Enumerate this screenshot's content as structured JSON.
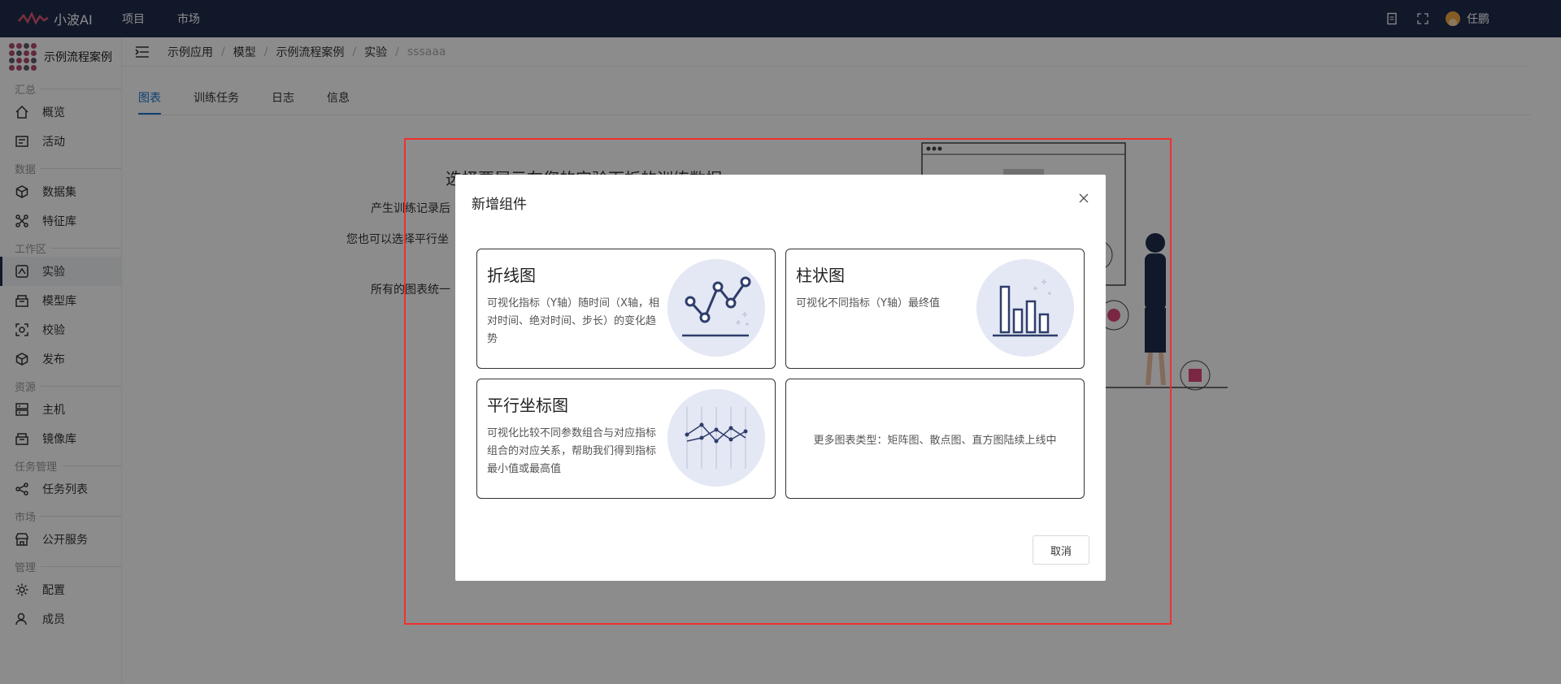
{
  "topbar": {
    "brand": "小波AI",
    "nav": [
      "项目",
      "市场"
    ],
    "user_name": "任鹏"
  },
  "sidebar": {
    "project_name": "示例流程案例",
    "groups": {
      "summary": "汇总",
      "data": "数据",
      "workspace": "工作区",
      "resource": "资源",
      "task": "任务管理",
      "market": "市场",
      "admin": "管理"
    },
    "items": {
      "overview": "概览",
      "activity": "活动",
      "dataset": "数据集",
      "feature": "特征库",
      "experiment": "实验",
      "models": "模型库",
      "validate": "校验",
      "publish": "发布",
      "host": "主机",
      "images": "镜像库",
      "tasks": "任务列表",
      "public_service": "公开服务",
      "config": "配置",
      "members": "成员"
    }
  },
  "breadcrumb": [
    "示例应用",
    "模型",
    "示例流程案例",
    "实验",
    "sssaaa"
  ],
  "tabs": [
    "图表",
    "训练任务",
    "日志",
    "信息"
  ],
  "background": {
    "title": "选择要展示在您的实验面板的训练数据",
    "line1": "产生训练记录后",
    "line2": "您也可以选择平行坐",
    "line3": "所有的图表统一"
  },
  "modal": {
    "title": "新增组件",
    "cards": [
      {
        "title": "折线图",
        "desc": "可视化指标（Y轴）随时间（X轴，相对时间、绝对时间、步长）的变化趋势"
      },
      {
        "title": "柱状图",
        "desc": "可视化不同指标（Y轴）最终值"
      },
      {
        "title": "平行坐标图",
        "desc": "可视化比较不同参数组合与对应指标组合的对应关系，帮助我们得到指标最小值或最高值"
      }
    ],
    "more": "更多图表类型：矩阵图、散点图、直方图陆续上线中",
    "cancel": "取消"
  },
  "colors": {
    "topbar": "#1f2d4e",
    "accent": "#1b76d1",
    "highlight": "#f03030"
  }
}
